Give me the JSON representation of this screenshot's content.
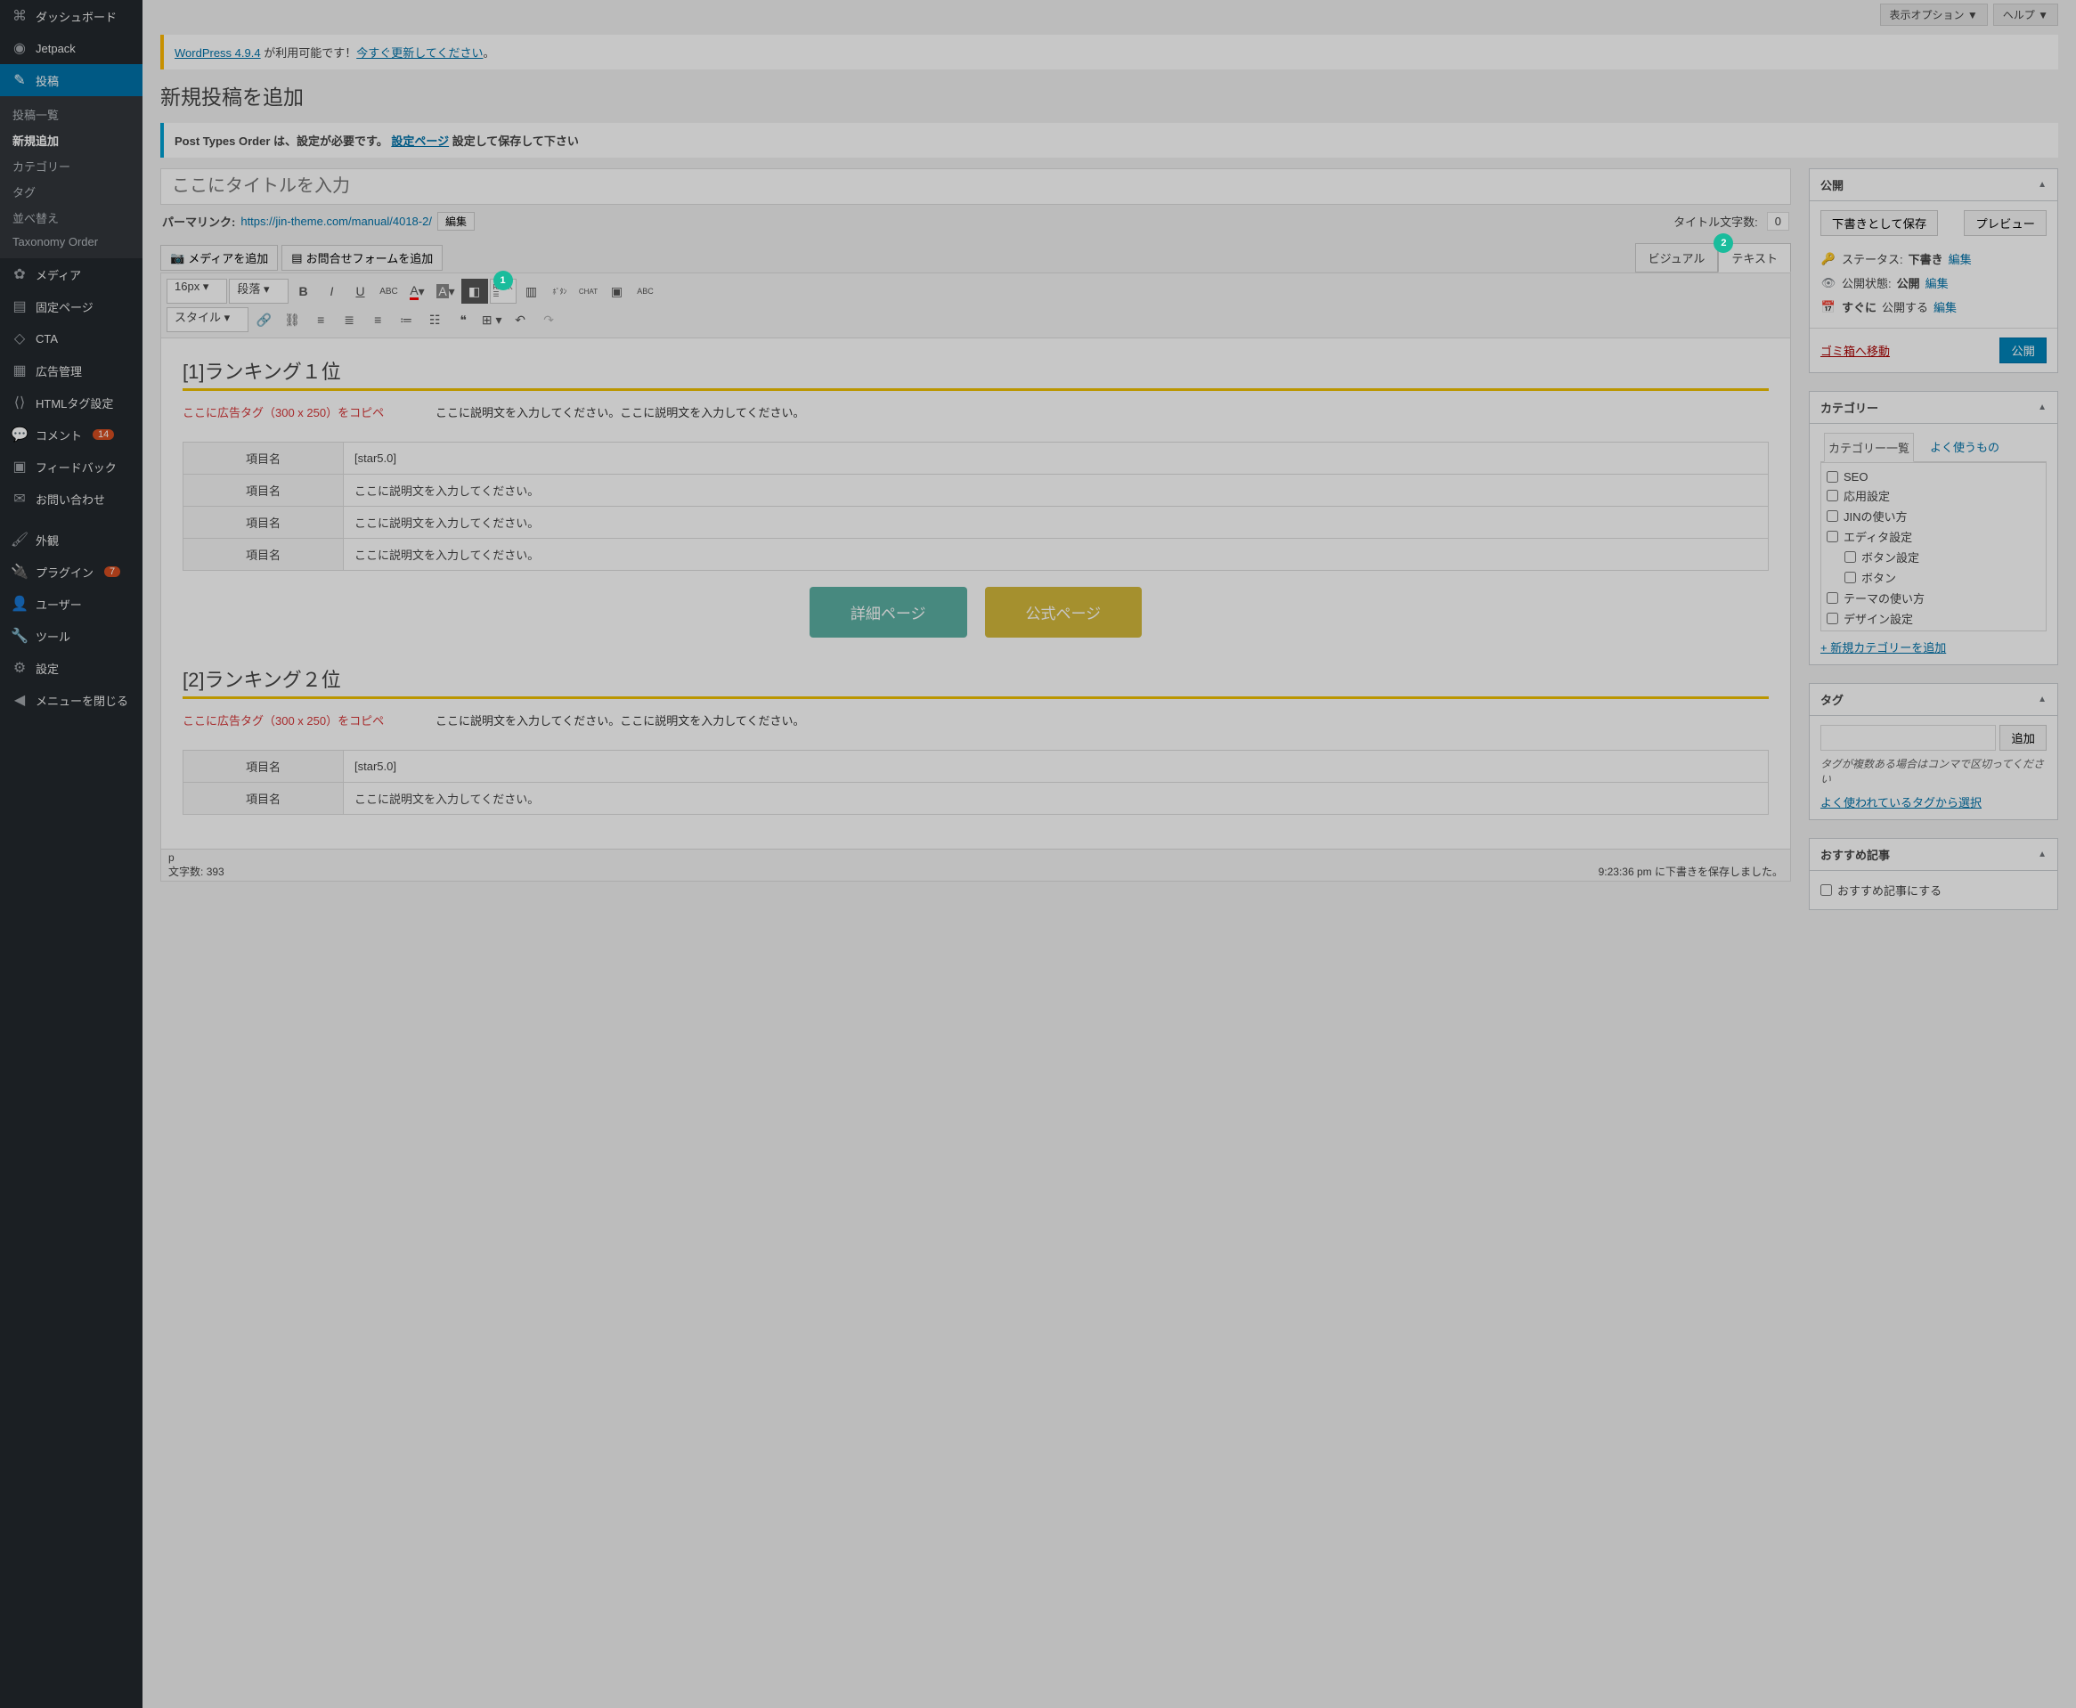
{
  "topbar": {
    "screen_options": "表示オプション",
    "help": "ヘルプ"
  },
  "sidebar": {
    "dashboard": "ダッシュボード",
    "jetpack": "Jetpack",
    "posts": "投稿",
    "post_sub": {
      "all": "投稿一覧",
      "new": "新規追加",
      "cat": "カテゴリー",
      "tag": "タグ",
      "reorder": "並べ替え",
      "tax": "Taxonomy Order"
    },
    "media": "メディア",
    "pages": "固定ページ",
    "cta": "CTA",
    "ads": "広告管理",
    "htmltag": "HTMLタグ設定",
    "comments": "コメント",
    "comments_badge": "14",
    "feedback": "フィードバック",
    "contact": "お問い合わせ",
    "appearance": "外観",
    "plugins": "プラグイン",
    "plugins_badge": "7",
    "users": "ユーザー",
    "tools": "ツール",
    "settings": "設定",
    "collapse": "メニューを閉じる"
  },
  "notices": {
    "wp_pre": "WordPress 4.9.4",
    "wp_mid": " が利用可能です！",
    "wp_link": "今すぐ更新してください",
    "wp_suf": "。",
    "pto_pre": "Post Types Order は、設定が必要です。 ",
    "pto_link": "設定ページ",
    "pto_suf": " 設定して保存して下さい"
  },
  "page_title": "新規投稿を追加",
  "editor": {
    "title_placeholder": "ここにタイトルを入力",
    "permalink_label": "パーマリンク:",
    "permalink_url": "https://jin-theme.com/manual/4018-2/",
    "permalink_edit": "編集",
    "title_chars_label": "タイトル文字数:",
    "title_chars": "0",
    "add_media": "メディアを追加",
    "add_contact": "お問合せフォームを追加",
    "tab_visual": "ビジュアル",
    "tab_text": "テキスト",
    "fontsize": "16px",
    "blockfmt": "段落",
    "styles": "スタイル",
    "statusbar_path": "p",
    "word_count_label": "文字数:",
    "word_count": "393",
    "autosave": "9:23:36 pm に下書きを保存しました。"
  },
  "ranks": [
    {
      "title": "[1]ランキング１位",
      "ad": "ここに広告タグ（300 x 250）をコピペ",
      "desc": "ここに説明文を入力してください。ここに説明文を入力してください。",
      "rows": [
        {
          "label": "項目名",
          "value": "[star5.0]"
        },
        {
          "label": "項目名",
          "value": "ここに説明文を入力してください。"
        },
        {
          "label": "項目名",
          "value": "ここに説明文を入力してください。"
        },
        {
          "label": "項目名",
          "value": "ここに説明文を入力してください。"
        }
      ],
      "btn_detail": "詳細ページ",
      "btn_official": "公式ページ"
    },
    {
      "title": "[2]ランキング２位",
      "ad": "ここに広告タグ（300 x 250）をコピペ",
      "desc": "ここに説明文を入力してください。ここに説明文を入力してください。",
      "rows": [
        {
          "label": "項目名",
          "value": "[star5.0]"
        },
        {
          "label": "項目名",
          "value": "ここに説明文を入力してください。"
        }
      ]
    }
  ],
  "publish": {
    "heading": "公開",
    "save_draft": "下書きとして保存",
    "preview": "プレビュー",
    "status_label": "ステータス:",
    "status_value": "下書き",
    "visibility_label": "公開状態:",
    "visibility_value": "公開",
    "schedule_pre": "すぐに",
    "schedule_action": "公開する",
    "edit": "編集",
    "trash": "ゴミ箱へ移動",
    "publish_btn": "公開"
  },
  "categories": {
    "heading": "カテゴリー",
    "tab_all": "カテゴリー一覧",
    "tab_freq": "よく使うもの",
    "items": [
      "SEO",
      "応用設定",
      "JINの使い方",
      "エディタ設定",
      "ボタン設定",
      "ボタン",
      "テーマの使い方",
      "デザイン設定"
    ],
    "add_new": "+ 新規カテゴリーを追加"
  },
  "tags": {
    "heading": "タグ",
    "add_btn": "追加",
    "hint": "タグが複数ある場合はコンマで区切ってください",
    "choose": "よく使われているタグから選択"
  },
  "recommend": {
    "heading": "おすすめ記事",
    "checkbox": "おすすめ記事にする"
  },
  "markers": {
    "one": "1",
    "two": "2"
  }
}
